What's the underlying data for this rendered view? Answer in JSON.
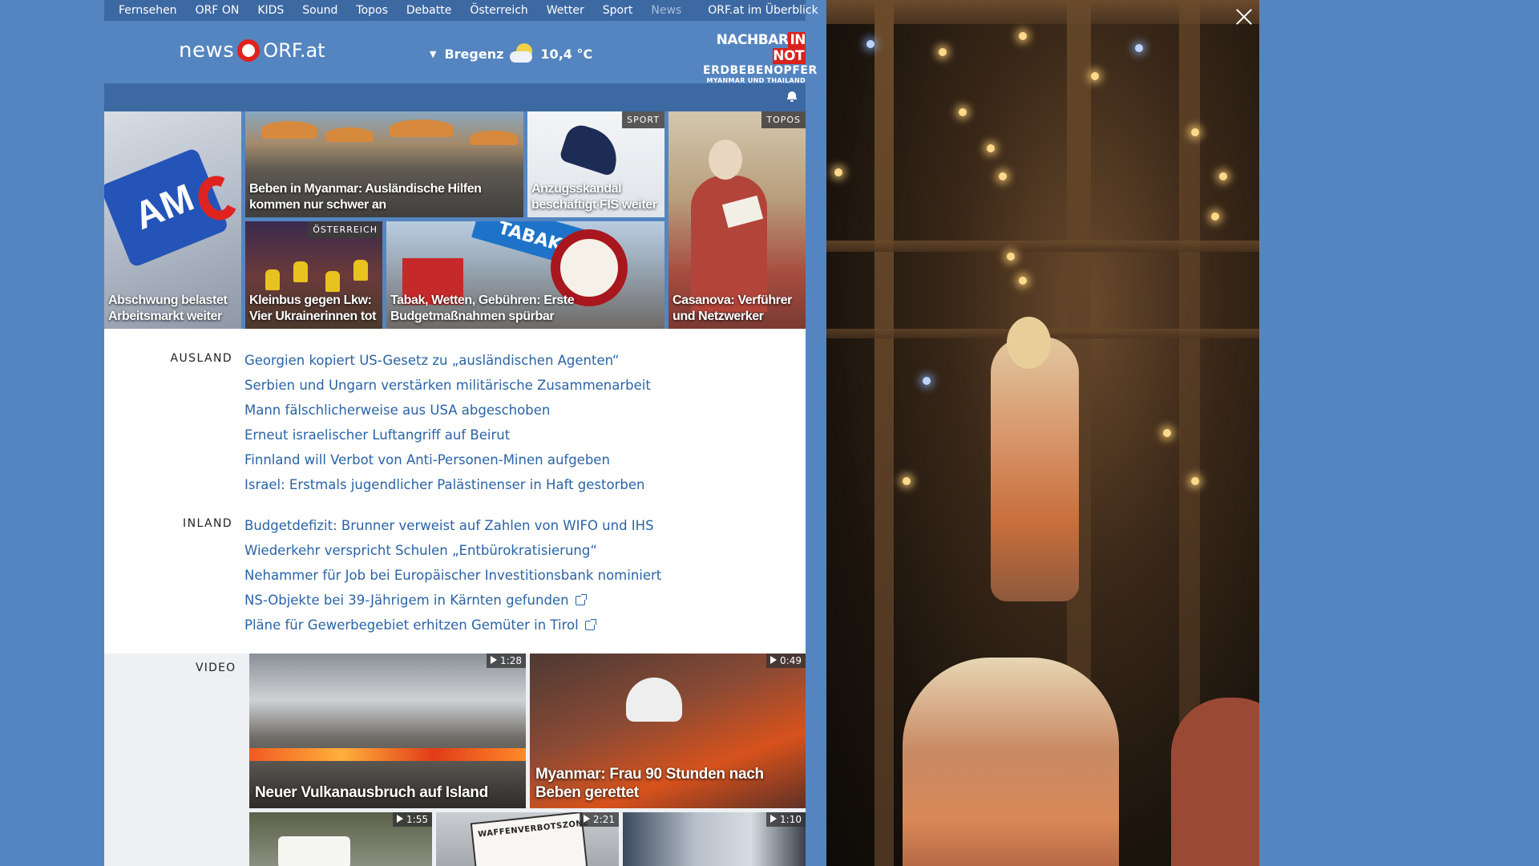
{
  "topnav": {
    "items": [
      "Fernsehen",
      "ORF ON",
      "KIDS",
      "Sound",
      "Topos",
      "Debatte",
      "Österreich",
      "Wetter",
      "Sport",
      "News"
    ],
    "active": "News",
    "overview": "ORF.at im Überblick"
  },
  "header": {
    "logo_news": "news",
    "logo_orf": "ORF.at",
    "weather": {
      "city": "Bregenz",
      "temp": "10,4 °C",
      "icon": "partly-cloudy-icon"
    },
    "promo": {
      "line1_a": "NACHBAR",
      "line1_b": "IN NOT",
      "line2": "ERDBEBENOPFER",
      "line3": "MYANMAR UND THAILAND"
    }
  },
  "hero": {
    "ams": {
      "caption": "Abschwung belastet Arbeitsmarkt weiter",
      "sign_text": "AM"
    },
    "myanmar": {
      "caption": "Beben in Myanmar: Ausländische Hilfen kommen nur schwer an"
    },
    "sport": {
      "tag": "SPORT",
      "caption": "Anzugsskandal beschäftigt FIS weiter"
    },
    "topos": {
      "tag": "TOPOS",
      "caption": "Casanova: Verführer und Netzwerker"
    },
    "bus": {
      "tag": "ÖSTERREICH",
      "caption": "Kleinbus gegen Lkw: Vier Ukrainerinnen tot"
    },
    "tabak": {
      "caption": "Tabak, Wetten, Gebühren: Erste Budgetmaßnahmen spürbar",
      "banner": "TABAK"
    }
  },
  "ausland": {
    "label": "AUSLAND",
    "items": [
      "Georgien kopiert US-Gesetz zu „ausländischen Agenten“",
      "Serbien und Ungarn verstärken militärische Zusammenarbeit",
      "Mann fälschlicherweise aus USA abgeschoben",
      "Erneut israelischer Luftangriff auf Beirut",
      "Finnland will Verbot von Anti-Personen-Minen aufgeben",
      "Israel: Erstmals jugendlicher Palästinenser in Haft gestorben"
    ]
  },
  "inland": {
    "label": "INLAND",
    "items": [
      "Budgetdefizit: Brunner verweist auf Zahlen von WIFO und IHS",
      "Wiederkehr verspricht Schulen „Entbürokratisierung“",
      "Nehammer für Job bei Europäischer Investitionsbank nominiert",
      "NS-Objekte bei 39-Jährigem in Kärnten gefunden",
      "Pläne für Gewerbegebiet erhitzen Gemüter in Tirol"
    ]
  },
  "video": {
    "label": "VIDEO",
    "items": [
      {
        "duration": "1:28",
        "caption": "Neuer Vulkanausbruch auf Island"
      },
      {
        "duration": "0:49",
        "caption": "Myanmar: Frau 90 Stunden nach Beben gerettet"
      },
      {
        "duration": "1:55",
        "caption": ""
      },
      {
        "duration": "2:21",
        "caption": "",
        "sign_text": "WAFFENVERBOTSZONE"
      },
      {
        "duration": "1:10",
        "caption": ""
      }
    ]
  },
  "colors": {
    "page_bg": "#5485c0",
    "nav_bg": "#3d69a3",
    "link": "#2a63a6",
    "orf_red": "#e2211c"
  }
}
